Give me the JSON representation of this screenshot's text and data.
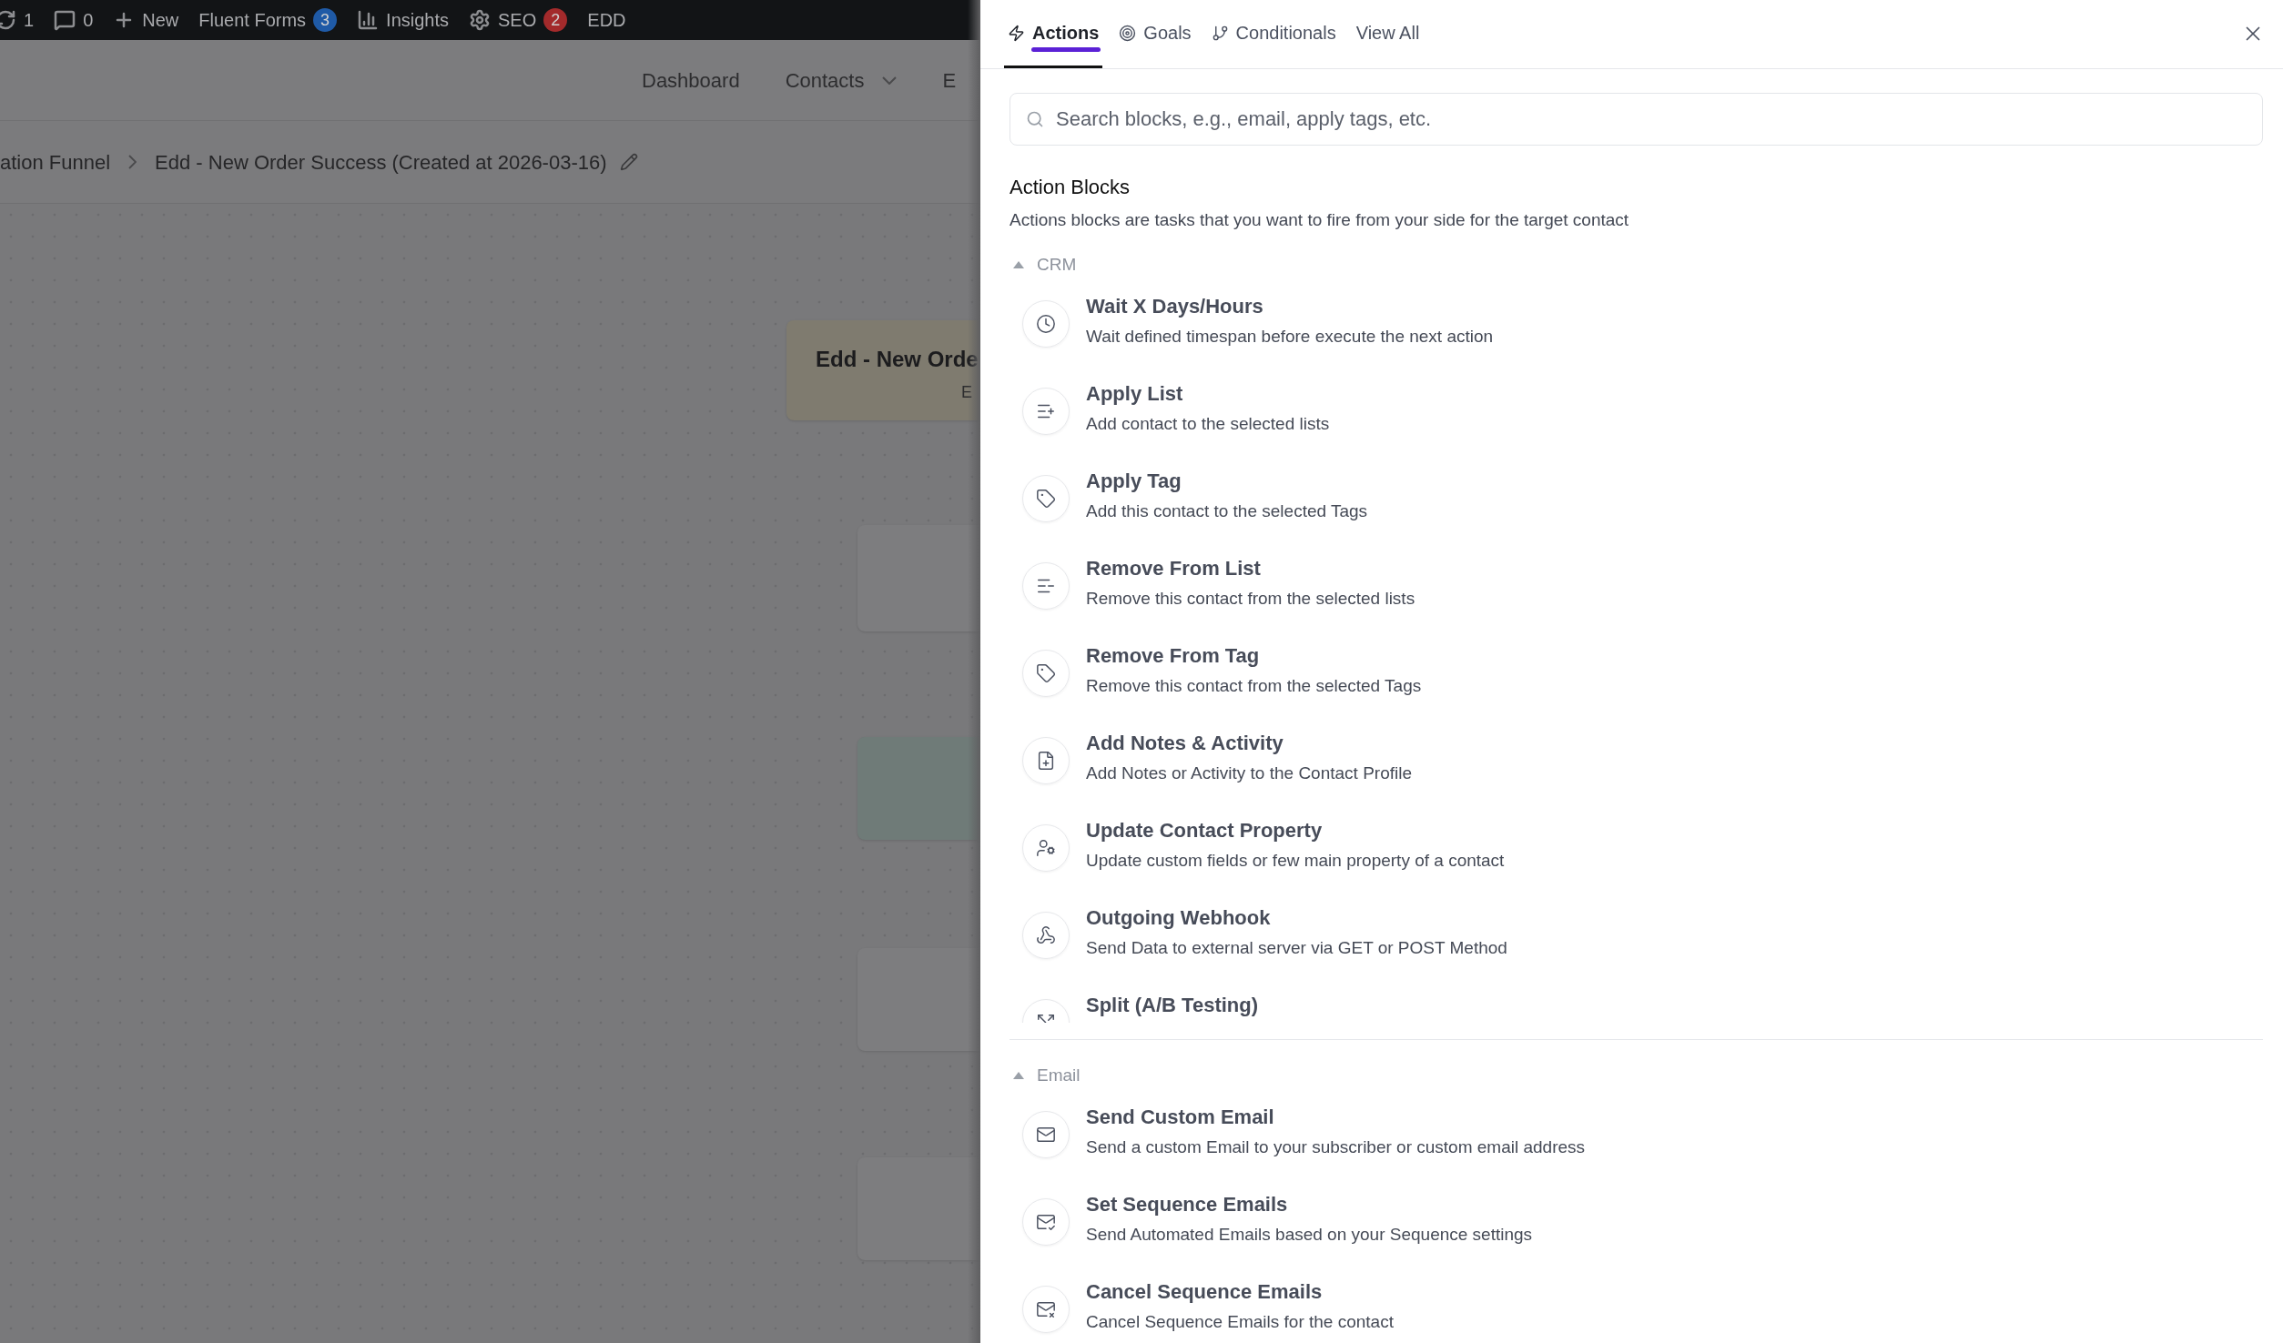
{
  "admin_bar": [
    {
      "kind": "updates",
      "label": "1"
    },
    {
      "kind": "comments",
      "label": "0"
    },
    {
      "kind": "new",
      "label": "New"
    },
    {
      "kind": "text",
      "label": "Fluent Forms",
      "badge": "3",
      "color": "#1f5aa6"
    },
    {
      "kind": "insights",
      "label": "Insights"
    },
    {
      "kind": "seo",
      "label": "SEO",
      "badge": "2",
      "color": "#a32a2b"
    },
    {
      "kind": "text",
      "label": "EDD"
    }
  ],
  "nav": {
    "items": [
      {
        "label": "Dashboard",
        "dropdown": false
      },
      {
        "label": "Contacts",
        "dropdown": true
      },
      {
        "label": "E",
        "dropdown": false
      }
    ]
  },
  "breadcrumb": {
    "parent": "ation Funnel",
    "current": "Edd - New Order Success (Created at 2026-03-16)"
  },
  "canvas": {
    "cards": [
      {
        "kind": "trigger",
        "title": "Edd - New Orde",
        "subtitle": "E"
      },
      {
        "kind": "action"
      },
      {
        "kind": "goal"
      },
      {
        "kind": "action"
      },
      {
        "kind": "action"
      }
    ]
  },
  "drawer": {
    "tabs": [
      {
        "label": "Actions",
        "kind": "actions",
        "selected": true
      },
      {
        "label": "Goals",
        "kind": "goals",
        "selected": false
      },
      {
        "label": "Conditionals",
        "kind": "conditionals",
        "selected": false
      },
      {
        "label": "View All",
        "kind": "all",
        "selected": false
      }
    ],
    "search": {
      "placeholder": "Search blocks, e.g., email, apply tags, etc."
    },
    "title": "Action Blocks",
    "description": "Actions blocks are tasks that you want to fire from your side for the target contact",
    "groups": [
      {
        "name": "CRM",
        "expanded": true,
        "items": [
          {
            "kind": "clock",
            "title": "Wait X Days/Hours",
            "description": "Wait defined timespan before execute the next action"
          },
          {
            "kind": "list-plus",
            "title": "Apply List",
            "description": "Add contact to the selected lists"
          },
          {
            "kind": "tag-plus",
            "title": "Apply Tag",
            "description": "Add this contact to the selected Tags"
          },
          {
            "kind": "list-minus",
            "title": "Remove From List",
            "description": "Remove this contact from the selected lists"
          },
          {
            "kind": "tag-x",
            "title": "Remove From Tag",
            "description": "Remove this contact from the selected Tags"
          },
          {
            "kind": "note",
            "title": "Add Notes & Activity",
            "description": "Add Notes or Activity to the Contact Profile"
          },
          {
            "kind": "property",
            "title": "Update Contact Property",
            "description": "Update custom fields or few main property of a contact"
          },
          {
            "kind": "webhook",
            "title": "Outgoing Webhook",
            "description": "Send Data to external server via GET or POST Method"
          },
          {
            "kind": "split",
            "title": "Split (A/B Testing)"
          }
        ]
      },
      {
        "name": "Email",
        "expanded": true,
        "items": [
          {
            "kind": "mail",
            "title": "Send Custom Email",
            "description": "Send a custom Email to your subscriber or custom email address"
          },
          {
            "kind": "mail-check",
            "title": "Set Sequence Emails",
            "description": "Send Automated Emails based on your Sequence settings"
          },
          {
            "kind": "mail-x",
            "title": "Cancel Sequence Emails",
            "description": "Cancel Sequence Emails for the contact"
          }
        ]
      }
    ]
  }
}
